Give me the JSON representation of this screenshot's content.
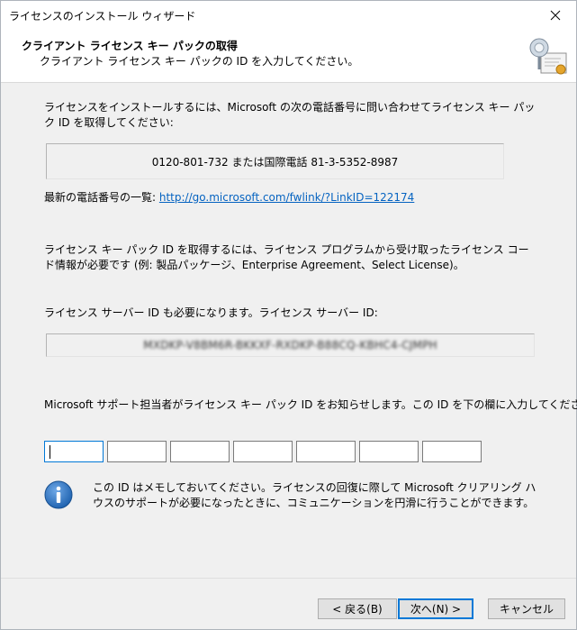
{
  "window": {
    "title": "ライセンスのインストール ウィザード"
  },
  "header": {
    "title": "クライアント ライセンス キー パックの取得",
    "subtitle": "クライアント ライセンス キー パックの ID を入力してください。"
  },
  "intro": "ライセンスをインストールするには、Microsoft の次の電話番号に問い合わせてライセンス キー パック ID を取得してください:",
  "phone": "0120-801-732 または国際電話 81-3-5352-8987",
  "latest": {
    "label": "最新の電話番号の一覧:",
    "link": "http://go.microsoft.com/fwlink/?LinkID=122174"
  },
  "license_info": "ライセンス キー パック ID を取得するには、ライセンス プログラムから受け取ったライセンス コード情報が必要です (例: 製品パッケージ、Enterprise Agreement、Select License)。",
  "server_id_label": "ライセンス サーバー ID も必要になります。ライセンス サーバー ID:",
  "server_id_value": "MXDKP-V8BM6R-BKKXF-RXDKP-B88CQ-KBHC4-CJMPH",
  "support_prompt": "Microsoft サポート担当者がライセンス キー パック ID をお知らせします。この ID を下の欄に入力してください。",
  "id_fields": [
    "",
    "",
    "",
    "",
    "",
    "",
    ""
  ],
  "note": "この ID はメモしておいてください。ライセンスの回復に際して Microsoft クリアリング ハウスのサポートが必要になったときに、コミュニケーションを円滑に行うことができます。",
  "buttons": {
    "back": "< 戻る(B)",
    "next": "次へ(N) >",
    "cancel": "キャンセル"
  },
  "colors": {
    "accent": "#0078d7",
    "link": "#0563c1",
    "info_icon": "#1b5fad"
  }
}
